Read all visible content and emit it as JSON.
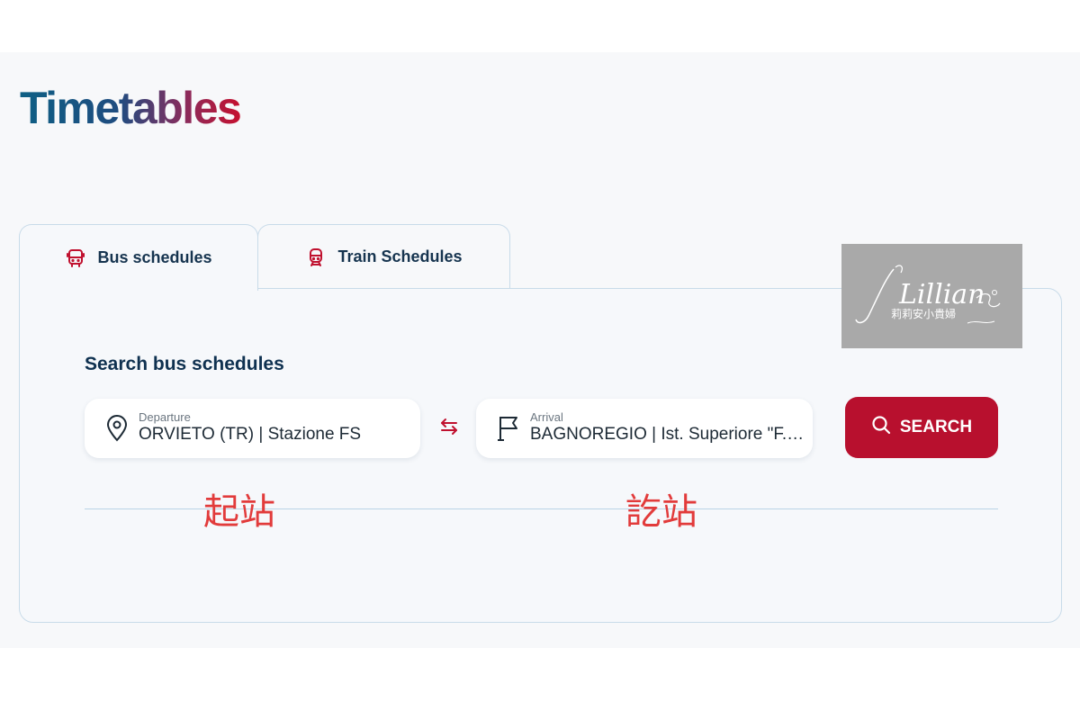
{
  "page": {
    "title": "Timetables"
  },
  "tabs": [
    {
      "label": "Bus schedules",
      "icon": "bus-icon",
      "active": true
    },
    {
      "label": "Train Schedules",
      "icon": "train-icon",
      "active": false
    }
  ],
  "search": {
    "heading": "Search bus schedules",
    "departure": {
      "label": "Departure",
      "value": "ORVIETO (TR) | Stazione FS",
      "icon": "map-pin-icon"
    },
    "arrival": {
      "label": "Arrival",
      "value": "BAGNOREGIO | Ist. Superiore \"F.lli Agosti\"",
      "icon": "flag-icon"
    },
    "swap_icon": "swap-arrows-icon",
    "button_label": "SEARCH",
    "button_icon": "search-icon"
  },
  "annotations": {
    "start": "起站",
    "end": "訖站"
  },
  "watermark": {
    "script_text": "Lillian",
    "subtitle": "莉莉安小貴婦"
  },
  "colors": {
    "accent": "#b8102e",
    "navy": "#0f3150",
    "annotation": "#e23b3b",
    "border": "#c8dbe9"
  }
}
